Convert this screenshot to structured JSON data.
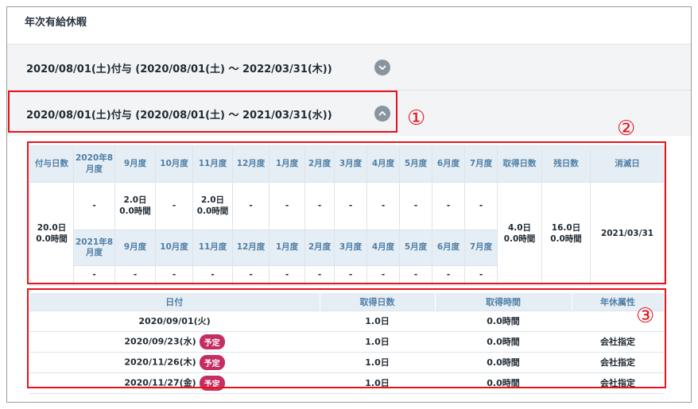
{
  "panel_title": "年次有給休暇",
  "accordion": [
    {
      "label": "2020/08/01(土)付与 (2020/08/01(土) ～ 2022/03/31(木))",
      "state": "collapsed"
    },
    {
      "label": "2020/08/01(土)付与 (2020/08/01(土) ～ 2021/03/31(水))",
      "state": "expanded"
    }
  ],
  "callouts": {
    "one": "①",
    "two": "②",
    "three": "③"
  },
  "summary": {
    "grant_header": "付与日数",
    "grant_value": "20.0日\n0.0時間",
    "months_row1": [
      "2020年8月度",
      "9月度",
      "10月度",
      "11月度",
      "12月度",
      "1月度",
      "2月度",
      "3月度",
      "4月度",
      "5月度",
      "6月度",
      "7月度"
    ],
    "values_row1": [
      "-",
      "2.0日\n0.0時間",
      "-",
      "2.0日\n0.0時間",
      "-",
      "-",
      "-",
      "-",
      "-",
      "-",
      "-",
      "-"
    ],
    "months_row2": [
      "2021年8月度",
      "9月度",
      "10月度",
      "11月度",
      "12月度",
      "1月度",
      "2月度",
      "3月度",
      "4月度",
      "5月度",
      "6月度",
      "7月度"
    ],
    "values_row2": [
      "-",
      "-",
      "-",
      "-",
      "-",
      "-",
      "-",
      "-",
      "-",
      "-",
      "-",
      "-"
    ],
    "taken_header": "取得日数",
    "taken_value": "4.0日\n0.0時間",
    "remaining_header": "残日数",
    "remaining_value": "16.0日\n0.0時間",
    "expiry_header": "消滅日",
    "expiry_value": "2021/03/31"
  },
  "list": {
    "headers": [
      "日付",
      "取得日数",
      "取得時間",
      "年休属性"
    ],
    "badge_label": "予定",
    "rows": [
      {
        "date": "2020/09/01(火)",
        "days": "1.0日",
        "hours": "0.0時間",
        "attr": "",
        "planned": false
      },
      {
        "date": "2020/09/23(水)",
        "days": "1.0日",
        "hours": "0.0時間",
        "attr": "会社指定",
        "planned": true
      },
      {
        "date": "2020/11/26(木)",
        "days": "1.0日",
        "hours": "0.0時間",
        "attr": "会社指定",
        "planned": true
      },
      {
        "date": "2020/11/27(金)",
        "days": "1.0日",
        "hours": "0.0時間",
        "attr": "会社指定",
        "planned": true
      }
    ]
  },
  "colors": {
    "callout": "#e8121b",
    "badge": "#c62d62",
    "header_bg": "#e6eef5",
    "header_text": "#4f7fa6",
    "accordion_bg": "#f2f4f6"
  }
}
